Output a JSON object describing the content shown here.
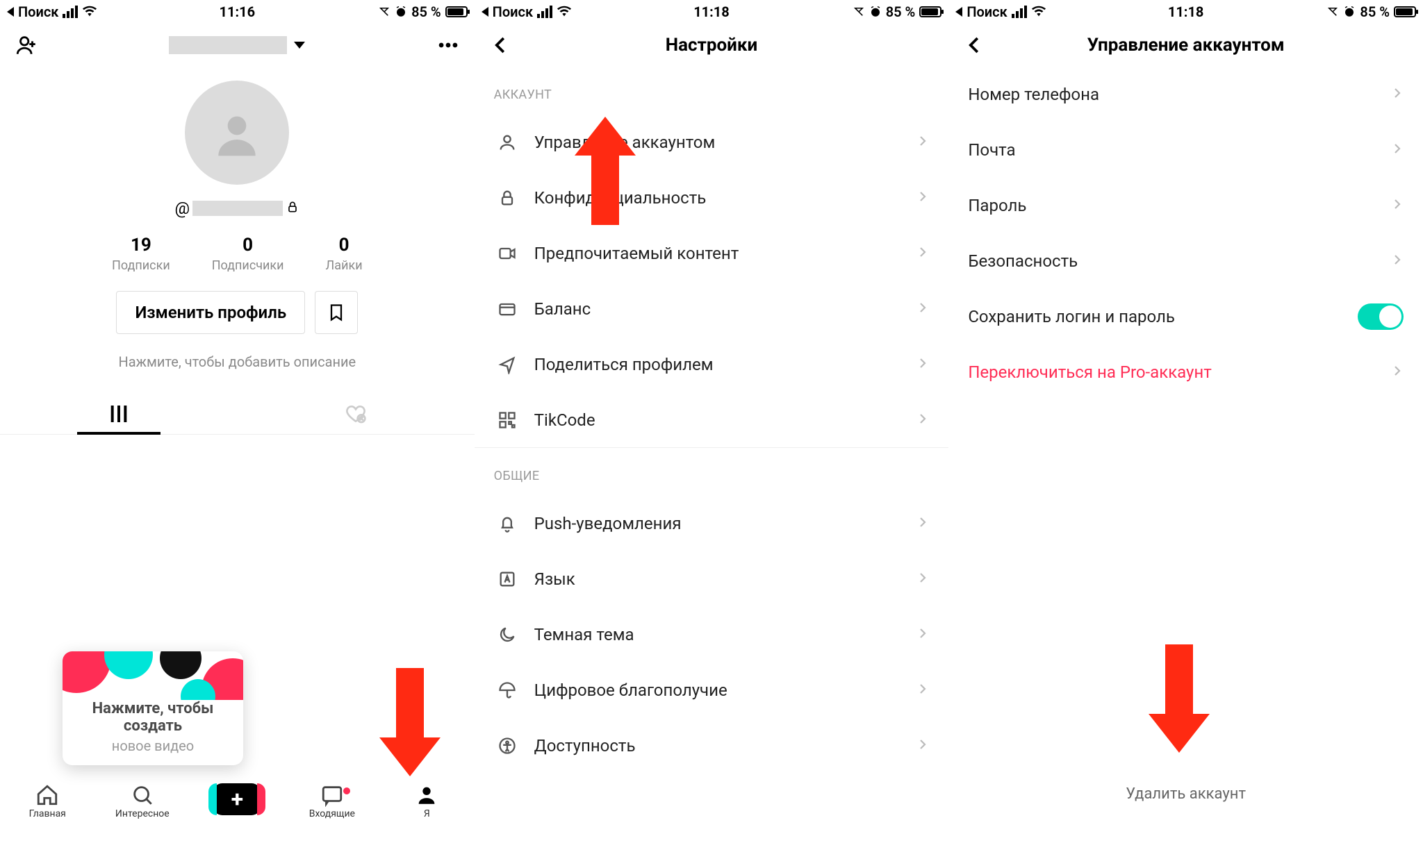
{
  "status": {
    "carrier": "Поиск",
    "time1": "11:16",
    "time2": "11:18",
    "time3": "11:18",
    "battery": "85 %"
  },
  "screen1": {
    "username_prefix": "@",
    "stats": {
      "following_num": "19",
      "following_lbl": "Подписки",
      "followers_num": "0",
      "followers_lbl": "Подписчики",
      "likes_num": "0",
      "likes_lbl": "Лайки"
    },
    "edit_profile": "Изменить профиль",
    "bio_hint": "Нажмите, чтобы добавить описание",
    "tooltip_l1": "Нажмите, чтобы",
    "tooltip_l2": "создать",
    "tooltip_l3": "новое видео",
    "tabbar": {
      "home": "Главная",
      "discover": "Интересное",
      "inbox": "Входящие",
      "me": "Я"
    }
  },
  "screen2": {
    "title": "Настройки",
    "section_account": "АККАУНТ",
    "rows_account": [
      "Управление аккаунтом",
      "Конфиденциальность",
      "Предпочитаемый контент",
      "Баланс",
      "Поделиться профилем",
      "TikCode"
    ],
    "section_general": "ОБЩИЕ",
    "rows_general": [
      "Push-уведомления",
      "Язык",
      "Темная тема",
      "Цифровое благополучие",
      "Доступность"
    ]
  },
  "screen3": {
    "title": "Управление аккаунтом",
    "rows": [
      "Номер телефона",
      "Почта",
      "Пароль",
      "Безопасность",
      "Сохранить логин и пароль",
      "Переключиться на Pro-аккаунт"
    ],
    "delete": "Удалить аккаунт"
  }
}
